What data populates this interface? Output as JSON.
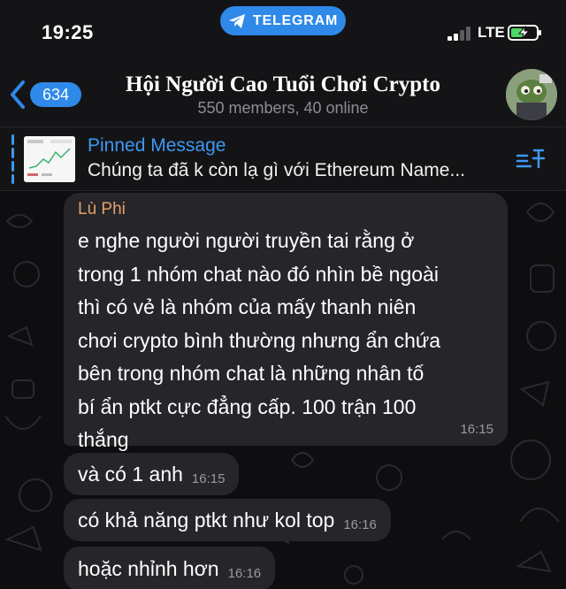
{
  "status_bar": {
    "time": "19:25",
    "app_pill": "TELEGRAM",
    "network": "LTE"
  },
  "header": {
    "back_count": "634",
    "title": "Hội Người Cao Tuổi Chơi Crypto",
    "subtitle": "550 members, 40 online"
  },
  "pinned": {
    "title": "Pinned Message",
    "text": "Chúng ta đã k còn lạ gì với Ethereum Name..."
  },
  "messages": [
    {
      "sender": "Lù Phi",
      "text": "e nghe người người truyền tai rằng ở\ntrong 1 nhóm chat nào đó nhìn bề ngoài\nthì có vẻ là nhóm của mấy thanh niên\nchơi crypto bình thường nhưng ẩn chứa\nbên trong nhóm chat là những nhân tố\nbí ẩn ptkt cực đẳng cấp. 100 trận 100\nthắng",
      "time": "16:15"
    },
    {
      "text": "và có 1 anh",
      "time": "16:15"
    },
    {
      "text": "có khả năng ptkt như kol top",
      "time": "16:16"
    },
    {
      "text": "hoặc nhỉnh hơn",
      "time": "16:16"
    }
  ],
  "colors": {
    "accent": "#2f89e8",
    "pinned_title": "#3e98f2",
    "sender_name": "#e3a26a",
    "bubble": "#262529",
    "battery_charging": "#4cd964"
  },
  "icons": [
    "telegram-plane-icon",
    "signal-bars-icon",
    "battery-charging-icon",
    "back-chevron-icon",
    "pinned-list-icon"
  ]
}
